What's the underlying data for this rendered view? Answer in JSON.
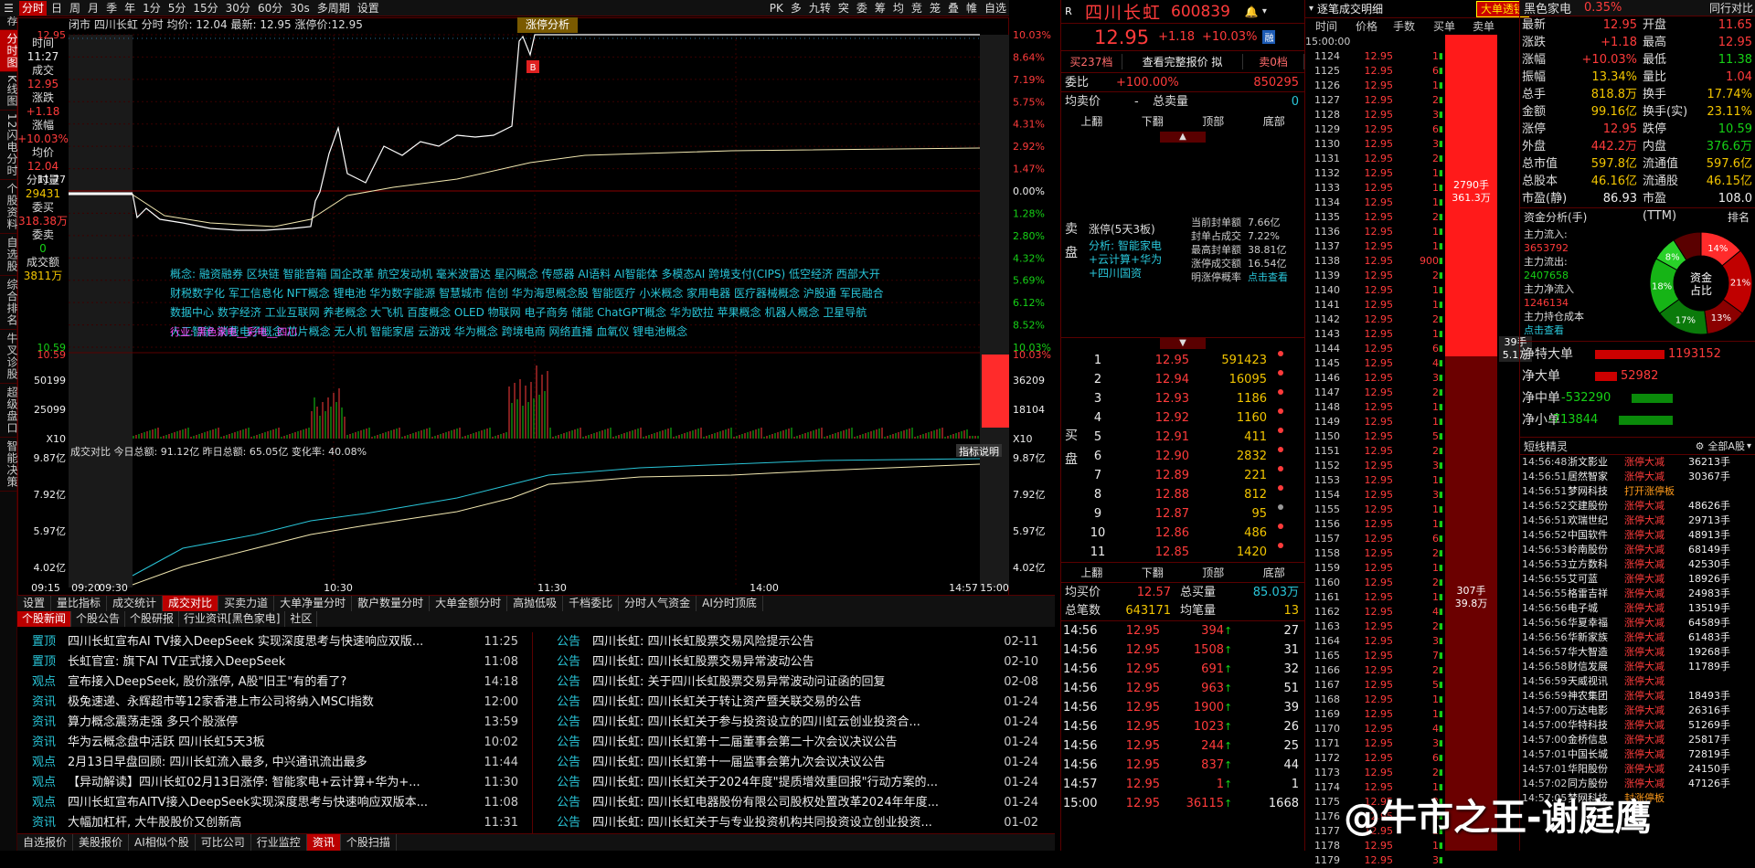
{
  "leftbar": [
    "推荐",
    "分时图",
    "K线图",
    "12闪电分时",
    "个股资料",
    "自选股",
    "综合排名",
    "牛叉诊股",
    "超级盘口",
    "智能决策"
  ],
  "toolbar": {
    "items": [
      "分时",
      "日",
      "周",
      "月",
      "季",
      "年",
      "1分",
      "5分",
      "15分",
      "30分",
      "60分",
      "30s",
      "多周期",
      "设置"
    ],
    "active": 0,
    "right": [
      "PK",
      "多",
      "九转",
      "突",
      "委",
      "筹",
      "均",
      "竞",
      "笼",
      "叠",
      "帷",
      "自选"
    ]
  },
  "header": {
    "line": "闭市  四川长虹 分时 均价: 12.04 最新: 12.95 涨停价:12.95",
    "badge": "涨停分析",
    "mark_b": "B"
  },
  "infocol": [
    {
      "k": "时间",
      "v": "11:27",
      "c": "wht"
    },
    {
      "k": "成交",
      "v": "12.95",
      "c": "red"
    },
    {
      "k": "涨跌",
      "v": "+1.18",
      "c": "red"
    },
    {
      "k": "涨幅",
      "v": "+10.03%",
      "c": "red"
    },
    {
      "k": "均价",
      "v": "12.04",
      "c": "red"
    },
    {
      "k": "分时量",
      "v": "29431",
      "c": "yel"
    },
    {
      "k": "委买",
      "v": "318.38万",
      "c": "red"
    },
    {
      "k": "委卖",
      "v": "0",
      "c": "grn"
    },
    {
      "k": "成交额",
      "v": "3811万",
      "c": "yel"
    }
  ],
  "price_axis_left": [
    "12.95",
    "",
    "",
    "",
    "",
    "",
    "11.77",
    "",
    "",
    "",
    "",
    "",
    "",
    "10.59"
  ],
  "price_axis_right": [
    "10.03%",
    "8.64%",
    "7.19%",
    "5.75%",
    "4.31%",
    "2.92%",
    "1.47%",
    "0.00%",
    "1.28%",
    "2.80%",
    "4.32%",
    "5.69%",
    "6.12%",
    "8.52%",
    "10.03%"
  ],
  "concepts": [
    "概念: 融资融券  区块链  智能音箱  国企改革  航空发动机  毫米波雷达  星闪概念  传感器  AI语料  AI智能体  多模态AI  跨境支付(CIPS)  低空经济  西部大开",
    "财税数字化  军工信息化  NFT概念  锂电池  华为数字能源  智慧城市  信创  华为海思概念股  智能医疗  小米概念  家用电器  医疗器械概念  沪股通  军民融合",
    "数据中心  数字经济  工业互联网  养老概念  大飞机  百度概念  OLED  物联网  电子商务  储能  ChatGPT概念  华为欧拉  苹果概念  机器人概念  卫星导航",
    "人工智能  消费电子概念  芯片概念  无人机  智能家居  云游戏  华为概念  跨境电商  网络直播  血氧仪  锂电池概念"
  ],
  "industry_tag": "行业: 黑色家电__彩电__四川",
  "vol_axis": {
    "left": [
      "50199",
      "25099",
      "X10"
    ],
    "right": [
      "36209",
      "18104",
      "X10"
    ]
  },
  "turnover": {
    "label": "成交对比 今日总额: 91.12亿 昨日总额: 65.05亿 变化率: 40.08%",
    "btn": "指标说明",
    "left": [
      "9.87亿",
      "7.92亿",
      "5.97亿",
      "4.02亿",
      "2.07亿"
    ],
    "right": [
      "9.87亿",
      "7.92亿",
      "5.97亿",
      "4.02亿",
      "2.07亿"
    ]
  },
  "time_axis": [
    "09:15",
    "09:20",
    "09:30",
    "10:30",
    "11:30",
    "14:00",
    "14:57",
    "15:00"
  ],
  "btabs": [
    "设置",
    "量比指标",
    "成交统计",
    "成交对比",
    "买卖力道",
    "大单净量分时",
    "散户数量分时",
    "大单金额分时",
    "高抛低吸",
    "千档委比",
    "分时人气资金",
    "AI分时顶底"
  ],
  "btab_active": 3,
  "ntabs": [
    "个股新闻",
    "个股公告",
    "个股研报",
    "行业资讯[黑色家电]",
    "社区"
  ],
  "news_left": [
    [
      "置顶",
      "四川长虹宣布AI TV接入DeepSeek 实现深度思考与快速响应双版...",
      "11:25"
    ],
    [
      "置顶",
      "长虹官宣: 旗下AI TV正式接入DeepSeek",
      "11:08"
    ],
    [
      "观点",
      "宣布接入DeepSeek, 股价涨停, A股\"旧王\"有的看了?",
      "14:18"
    ],
    [
      "资讯",
      "极兔速递、永辉超市等12家香港上市公司将纳入MSCI指数",
      "12:00"
    ],
    [
      "资讯",
      "算力概念震荡走强 多只个股涨停",
      "13:59"
    ],
    [
      "资讯",
      "华为云概念盘中活跃 四川长虹5天3板",
      "10:02"
    ],
    [
      "观点",
      "2月13日早盘回顾: 四川长虹流入最多, 中兴通讯流出最多",
      "11:44"
    ],
    [
      "观点",
      "【异动解读】四川长虹02月13日涨停: 智能家电+云计算+华为+...",
      "11:30"
    ],
    [
      "观点",
      "四川长虹宣布AITV接入DeepSeek实现深度思考与快速响应双版本...",
      "11:08"
    ],
    [
      "资讯",
      "大幅加杠杆, 大牛股股价又创新高",
      "11:31"
    ]
  ],
  "news_right": [
    [
      "公告",
      "四川长虹: 四川长虹股票交易风险提示公告",
      "02-11"
    ],
    [
      "公告",
      "四川长虹: 四川长虹股票交易异常波动公告",
      "02-10"
    ],
    [
      "公告",
      "四川长虹: 关于四川长虹股票交易异常波动问证函的回复",
      "02-08"
    ],
    [
      "公告",
      "四川长虹: 四川长虹关于转让资产暨关联交易的公告",
      "01-24"
    ],
    [
      "公告",
      "四川长虹: 四川长虹关于参与投资设立的四川虹云创业投资合...",
      "01-24"
    ],
    [
      "公告",
      "四川长虹: 四川长虹第十二届董事会第二十次会议决议公告",
      "01-24"
    ],
    [
      "公告",
      "四川长虹: 四川长虹第十一届监事会第九次会议决议公告",
      "01-24"
    ],
    [
      "公告",
      "四川长虹: 四川长虹关于2024年度\"提质增效重回报\"行动方案的...",
      "01-24"
    ],
    [
      "公告",
      "四川长虹: 四川长虹电器股份有限公司股权处置改革2024年年度...",
      "01-24"
    ],
    [
      "公告",
      "四川长虹: 四川长虹关于与专业投资机构共同投资设立创业投资...",
      "01-02"
    ]
  ],
  "bottombar": [
    "自选报价",
    "美股报价",
    "AI相似个股",
    "可比公司",
    "行业监控",
    "资讯",
    "个股扫描"
  ],
  "bottom_active": 5,
  "quote": {
    "code": "R",
    "name": "四川长虹",
    "ticker": "600839",
    "price": "12.95",
    "chg": "+1.18",
    "pct": "+10.03%",
    "tag": "融",
    "bar": [
      "买237档",
      "查看完整报价 拟",
      "卖0档"
    ],
    "wb_k": "委比",
    "wb_v": "+100.00%",
    "wb_n": "850295",
    "jmj_k": "均卖价",
    "jmj_v": "-",
    "zml_k": "总卖量",
    "zml_v": "0",
    "nav": [
      "上翻",
      "下翻",
      "顶部",
      "底部"
    ],
    "sell_lbl": "卖盘",
    "buy_lbl": "买盘",
    "limit_title": "涨停(5天3板)",
    "limit_stats": [
      [
        "当前封单额",
        "7.66亿"
      ],
      [
        "封单占成交",
        "7.22%"
      ],
      [
        "最高封单额",
        "38.81亿"
      ],
      [
        "涨停成交额",
        "16.54亿"
      ],
      [
        "明涨停概率",
        "点击查看"
      ]
    ],
    "analysis": "分析: 智能家电+云计算+华为+四川国资",
    "bids": [
      [
        "1",
        "12.95",
        "591423"
      ],
      [
        "2",
        "12.94",
        "16095"
      ],
      [
        "3",
        "12.93",
        "1186"
      ],
      [
        "4",
        "12.92",
        "1160"
      ],
      [
        "5",
        "12.91",
        "411"
      ],
      [
        "6",
        "12.90",
        "2832"
      ],
      [
        "7",
        "12.89",
        "221"
      ],
      [
        "8",
        "12.88",
        "812"
      ],
      [
        "9",
        "12.87",
        "95"
      ],
      [
        "10",
        "12.86",
        "486"
      ],
      [
        "11",
        "12.85",
        "1420"
      ]
    ],
    "jmj2_k": "均买价",
    "jmj2_v": "12.57",
    "zml2_k": "总买量",
    "zml2_v": "85.03万",
    "zbs_k": "总笔数",
    "zbs_v": "643171",
    "jbl_k": "均笔量",
    "jbl_v": "13",
    "ticks": [
      [
        "14:56",
        "12.95",
        "394",
        "27"
      ],
      [
        "14:56",
        "12.95",
        "1508",
        "31"
      ],
      [
        "14:56",
        "12.95",
        "691",
        "32"
      ],
      [
        "14:56",
        "12.95",
        "963",
        "51"
      ],
      [
        "14:56",
        "12.95",
        "1900",
        "39"
      ],
      [
        "14:56",
        "12.95",
        "1023",
        "26"
      ],
      [
        "14:56",
        "12.95",
        "244",
        "25"
      ],
      [
        "14:56",
        "12.95",
        "837",
        "44"
      ],
      [
        "14:57",
        "12.95",
        "1",
        "1"
      ],
      [
        "15:00",
        "12.95",
        "36115",
        "1668"
      ]
    ]
  },
  "trades": {
    "title": "逐笔成交明细",
    "bigbtn": "大单透镜",
    "cols": [
      "时间",
      "价格",
      "手数",
      "买单",
      "卖单"
    ],
    "first_time": "15:00:00",
    "rows_start": 1124,
    "bar_top_label1": "2790手",
    "bar_top_label2": "361.3万",
    "mid_label1": "39手",
    "mid_label2": "5.1万",
    "bar_bot_label1": "307手",
    "bar_bot_label2": "39.8万",
    "nums": [
      "1",
      "6",
      "1",
      "2",
      "3",
      "6",
      "3",
      "2",
      "1",
      "1",
      "1",
      "2",
      "1",
      "1",
      "900",
      "2",
      "1",
      "1",
      "2",
      "1",
      "6",
      "4",
      "3",
      "2",
      "1",
      "1",
      "5",
      "2",
      "3",
      "1",
      "3",
      "1",
      "1",
      "6",
      "2",
      "1",
      "2",
      "1",
      "4",
      "2",
      "3",
      "7",
      "2",
      "5",
      "1",
      "1",
      "4",
      "3",
      "6",
      "2",
      "1",
      "2",
      "8",
      "1",
      "1",
      "3"
    ]
  },
  "right": {
    "name": "黑色家电",
    "name_pct": "0.35%",
    "btn": "同行对比",
    "kv": [
      [
        "最新",
        "12.95",
        "red",
        "开盘",
        "11.65",
        "red"
      ],
      [
        "涨跌",
        "+1.18",
        "red",
        "最高",
        "12.95",
        "red"
      ],
      [
        "涨幅",
        "+10.03%",
        "red",
        "最低",
        "11.38",
        "grn"
      ],
      [
        "振幅",
        "13.34%",
        "yel",
        "量比",
        "1.04",
        "red"
      ],
      [
        "总手",
        "818.8万",
        "yel",
        "换手",
        "17.74%",
        "yel"
      ],
      [
        "金额",
        "99.16亿",
        "yel",
        "换手(实)",
        "23.11%",
        "yel"
      ],
      [
        "涨停",
        "12.95",
        "red",
        "跌停",
        "10.59",
        "grn"
      ],
      [
        "外盘",
        "442.2万",
        "red",
        "内盘",
        "376.6万",
        "grn"
      ],
      [
        "总市值",
        "597.8亿",
        "yel",
        "流通值",
        "597.6亿",
        "yel"
      ],
      [
        "总股本",
        "46.16亿",
        "yel",
        "流通股",
        "46.15亿",
        "yel"
      ],
      [
        "市盈(静)",
        "86.93",
        "wht",
        "市盈(TTM)",
        "108.0",
        "wht"
      ]
    ],
    "fund_title": "资金分析(手)",
    "fund_rank": "排名",
    "fund_items": [
      [
        "主力流入:",
        "3653792"
      ],
      [
        "主力流出:",
        "2407658"
      ],
      [
        "主力净流入",
        "1246134"
      ],
      [
        "主力持仓成本",
        ""
      ],
      [
        "点击查看",
        ""
      ]
    ],
    "pie_center": [
      "资金",
      "占比"
    ],
    "pie": [
      {
        "v": 14,
        "c": "#ff2b2b",
        "l": "14%"
      },
      {
        "v": 21,
        "c": "#c00000",
        "l": "21%"
      },
      {
        "v": 13,
        "c": "#8b0000",
        "l": "13%"
      },
      {
        "v": 17,
        "c": "#0a7a0a",
        "l": "17%"
      },
      {
        "v": 18,
        "c": "#16b416",
        "l": "18%"
      },
      {
        "v": 8,
        "c": "#29d129",
        "l": "8%"
      },
      {
        "v": 9,
        "c": "#5a0000",
        "l": ""
      }
    ],
    "flows": [
      [
        "净特大单",
        "1193152",
        0.95,
        "red"
      ],
      [
        "净大单",
        "52982",
        0.3,
        "red"
      ],
      [
        "净中单",
        "-532290",
        0.5,
        "grn"
      ],
      [
        "净小单",
        "-713844",
        0.65,
        "grn"
      ]
    ],
    "st_title": "短线精灵",
    "st_market": "全部A股",
    "st_rows": [
      [
        "14:56:48",
        "浙文影业",
        "涨停大减",
        "36213手"
      ],
      [
        "14:56:51",
        "居然智家",
        "涨停大减",
        "30367手"
      ],
      [
        "14:56:51",
        "梦网科技",
        "打开涨停板",
        ""
      ],
      [
        "14:56:52",
        "交建股份",
        "涨停大减",
        "48626手"
      ],
      [
        "14:56:51",
        "欢瑞世纪",
        "涨停大减",
        "29713手"
      ],
      [
        "14:56:52",
        "中国软件",
        "涨停大减",
        "48913手"
      ],
      [
        "14:56:53",
        "岭南股份",
        "涨停大减",
        "68149手"
      ],
      [
        "14:56:53",
        "立方数科",
        "涨停大减",
        "42530手"
      ],
      [
        "14:56:55",
        "艾可蓝",
        "涨停大减",
        "18926手"
      ],
      [
        "14:56:55",
        "格雷吉祥",
        "涨停大减",
        "24983手"
      ],
      [
        "14:56:56",
        "电子城",
        "涨停大减",
        "13519手"
      ],
      [
        "14:56:56",
        "华夏幸福",
        "涨停大减",
        "64589手"
      ],
      [
        "14:56:56",
        "华新家族",
        "涨停大减",
        "61483手"
      ],
      [
        "14:56:57",
        "华大智造",
        "涨停大减",
        "19268手"
      ],
      [
        "14:56:58",
        "财信发展",
        "涨停大减",
        "11789手"
      ],
      [
        "14:56:59",
        "天威视讯",
        "涨停大减",
        ""
      ],
      [
        "14:56:59",
        "神农集团",
        "涨停大减",
        "18493手"
      ],
      [
        "14:57:00",
        "万达电影",
        "涨停大减",
        "26316手"
      ],
      [
        "14:57:00",
        "华特科技",
        "涨停大减",
        "51269手"
      ],
      [
        "14:57:00",
        "金桥信息",
        "涨停大减",
        "25817手"
      ],
      [
        "14:57:01",
        "中国长城",
        "涨停大减",
        "72819手"
      ],
      [
        "14:57:01",
        "华阳股份",
        "涨停大减",
        "24150手"
      ],
      [
        "14:57:02",
        "同方股份",
        "涨停大减",
        "47126手"
      ],
      [
        "14:57:05",
        "梦网科技",
        "封涨停板",
        ""
      ]
    ]
  },
  "watermark": "@牛市之王-谢庭鹰"
}
